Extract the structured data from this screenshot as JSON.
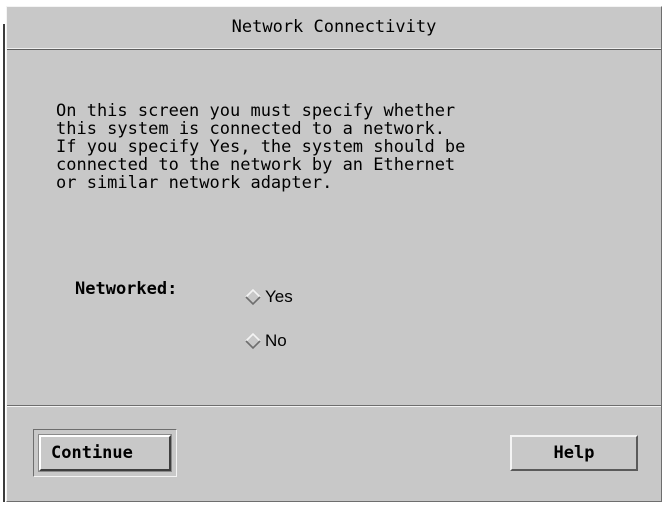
{
  "dialog": {
    "title": "Network Connectivity",
    "description": "On this screen you must specify whether\nthis system is connected to a network.\nIf you specify Yes, the system should be\nconnected to the network by an Ethernet\nor similar network adapter.",
    "networked_label": "Networked:",
    "options": [
      {
        "label": "Yes",
        "selected": false
      },
      {
        "label": "No",
        "selected": false
      }
    ]
  },
  "buttons": {
    "continue_label": "Continue",
    "help_label": "Help"
  },
  "colors": {
    "background": "#c8c8c8",
    "highlight": "#f4f4f4",
    "shadow": "#6e6e6e",
    "text": "#000000"
  },
  "icons": {
    "radio": "diamond-radio-icon"
  }
}
